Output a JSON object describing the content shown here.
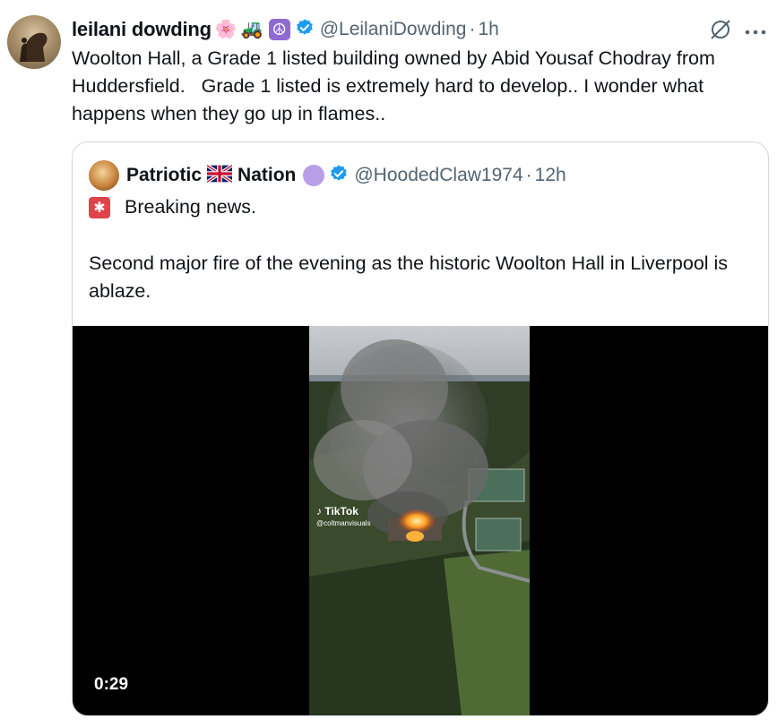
{
  "tweet": {
    "author_name": "leilani dowding",
    "emojis": [
      "🌸",
      "🚜"
    ],
    "peace_symbol": "☮",
    "handle": "@LeilaniDowding",
    "separator": "·",
    "time": "1h",
    "text": "Woolton Hall, a Grade 1 listed building owned by Abid Yousaf Chodray from Huddersfield.   Grade 1 listed is extremely hard to develop.. I wonder what happens when they go up in flames..",
    "icons": [
      "grok-icon",
      "more-icon"
    ]
  },
  "quote": {
    "author_name_part1": "Patriotic",
    "author_name_part2": "Nation",
    "handle": "@HoodedClaw1974",
    "separator": "·",
    "time": "12h",
    "line1": "Breaking news.",
    "line2": "Second major fire of the evening as the historic Woolton Hall in Liverpool is ablaze.",
    "video": {
      "duration": "0:29",
      "watermark": "TikTok",
      "watermark_handle": "@coltmanvisuals"
    }
  },
  "colors": {
    "verified": "#1d9bf0",
    "muted_text": "#536471",
    "border": "#cfd9de"
  }
}
